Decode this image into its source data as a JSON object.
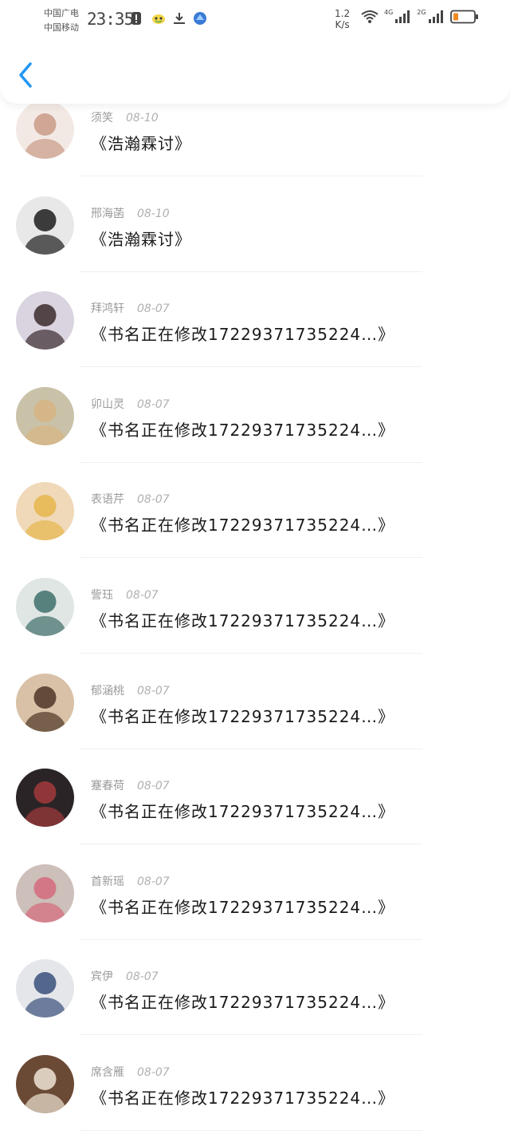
{
  "status_bar": {
    "carrier_line1": "中国广电",
    "carrier_line2": "中国移动",
    "time": "23:35",
    "net_speed_value": "1.2",
    "net_speed_unit": "K/s",
    "signal1_label": "4G",
    "signal2_label": "2G",
    "icons": [
      "notification-icon",
      "chat-app-icon",
      "download-icon",
      "app-icon",
      "wifi-icon",
      "signal-4g-icon",
      "signal-2g-icon",
      "battery-icon"
    ]
  },
  "nav": {
    "back_icon": "chevron-left-icon"
  },
  "comments": [
    {
      "name": "须笑",
      "date": "08-10",
      "text": "《浩瀚霖讨》",
      "avatar_colors": [
        "#f3e9e4",
        "#c99a87"
      ]
    },
    {
      "name": "邢海菡",
      "date": "08-10",
      "text": "《浩瀚霖讨》",
      "avatar_colors": [
        "#e8e8e8",
        "#1c1c1c"
      ]
    },
    {
      "name": "拜鸿轩",
      "date": "08-07",
      "text": "《书名正在修改17229371735224…》",
      "avatar_colors": [
        "#d9d4df",
        "#3b2a2e"
      ]
    },
    {
      "name": "卯山灵",
      "date": "08-07",
      "text": "《书名正在修改17229371735224…》",
      "avatar_colors": [
        "#c9c2a8",
        "#d8b383"
      ]
    },
    {
      "name": "表语芹",
      "date": "08-07",
      "text": "《书名正在修改17229371735224…》",
      "avatar_colors": [
        "#f0d9b9",
        "#e6b54c"
      ]
    },
    {
      "name": "訾珏",
      "date": "08-07",
      "text": "《书名正在修改17229371735224…》",
      "avatar_colors": [
        "#dfe6e3",
        "#3f6e6b"
      ]
    },
    {
      "name": "郁涵桃",
      "date": "08-07",
      "text": "《书名正在修改17229371735224…》",
      "avatar_colors": [
        "#d8c1a6",
        "#4d3627"
      ]
    },
    {
      "name": "蹇春荷",
      "date": "08-07",
      "text": "《书名正在修改17229371735224…》",
      "avatar_colors": [
        "#2a2426",
        "#a33a3c"
      ]
    },
    {
      "name": "首新瑶",
      "date": "08-07",
      "text": "《书名正在修改17229371735224…》",
      "avatar_colors": [
        "#cdbfb9",
        "#d46a7c"
      ]
    },
    {
      "name": "宾伊",
      "date": "08-07",
      "text": "《书名正在修改17229371735224…》",
      "avatar_colors": [
        "#e4e6ea",
        "#3a4f7a"
      ]
    },
    {
      "name": "席含雁",
      "date": "08-07",
      "text": "《书名正在修改17229371735224…》",
      "avatar_colors": [
        "#6b4a35",
        "#efe4d6"
      ]
    }
  ],
  "colors": {
    "accent": "#2196f3",
    "name_text": "#9a9a9a",
    "comment_text": "#1a1a1a",
    "divider": "#f0f0f0",
    "battery_level": "#f08a24"
  }
}
